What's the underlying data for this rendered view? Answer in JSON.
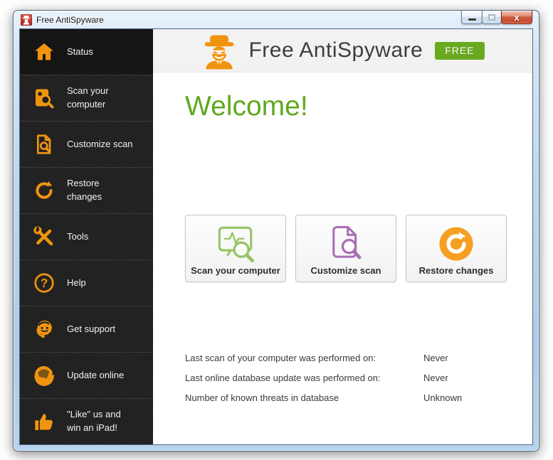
{
  "titlebar": {
    "title": "Free AntiSpyware"
  },
  "icons": {
    "close_glyph": "x",
    "question_glyph": "?"
  },
  "sidebar": {
    "items": [
      {
        "label": "Status",
        "icon": "home-icon",
        "active": true
      },
      {
        "label": "Scan your computer",
        "icon": "drive-scan-icon",
        "active": false
      },
      {
        "label": "Customize scan",
        "icon": "document-scan-icon",
        "active": false
      },
      {
        "label": "Restore changes",
        "icon": "restore-arrows-icon",
        "active": false
      },
      {
        "label": "Tools",
        "icon": "tools-icon",
        "active": false
      },
      {
        "label": "Help",
        "icon": "help-icon",
        "active": false
      },
      {
        "label": "Get support",
        "icon": "support-headset-icon",
        "active": false
      },
      {
        "label": "Update online",
        "icon": "update-globe-icon",
        "active": false
      },
      {
        "label": "\"Like\" us and win an iPad!",
        "icon": "thumbs-up-icon",
        "active": false
      }
    ]
  },
  "header": {
    "app_name": "Free AntiSpyware",
    "badge_label": "FREE"
  },
  "main": {
    "welcome_title": "Welcome!",
    "action_buttons": [
      {
        "label": "Scan your computer",
        "icon": "monitor-scan-icon"
      },
      {
        "label": "Customize scan",
        "icon": "document-scan-icon"
      },
      {
        "label": "Restore changes",
        "icon": "restore-circle-icon"
      }
    ],
    "status_rows": [
      {
        "label": "Last scan of your computer was performed on:",
        "value": "Never"
      },
      {
        "label": "Last online database update was performed on:",
        "value": "Never"
      },
      {
        "label": "Number of known threats in database",
        "value": "Unknown"
      }
    ]
  },
  "colors": {
    "accent_orange": "#F0940F",
    "welcome_green": "#5FA91D",
    "badge_green": "#69AA20",
    "scan_green": "#94C464",
    "customize_purple": "#A96FB5",
    "restore_orange": "#F5A023",
    "sidebar_dark": "#202020",
    "header_gray": "#F2F2F2"
  }
}
